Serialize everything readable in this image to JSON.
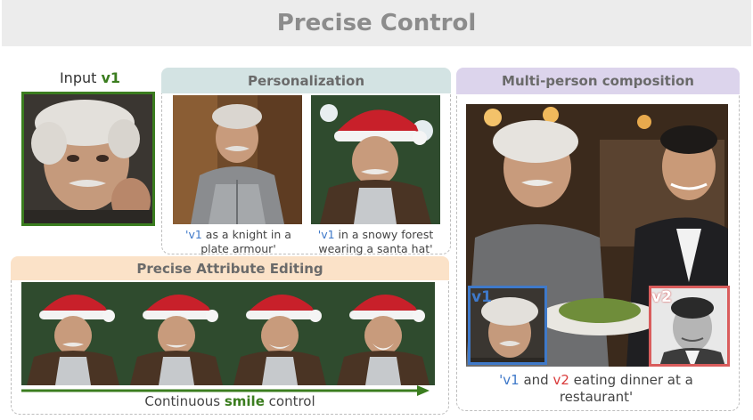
{
  "title": "Precise Control",
  "input": {
    "label_prefix": "Input ",
    "label_token": "v1"
  },
  "personalization": {
    "header": "Personalization",
    "captions": [
      {
        "token": "'v1",
        "text": " as a knight in a plate armour'"
      },
      {
        "token": "'v1",
        "text": " in a snowy forest wearing a santa hat'"
      }
    ]
  },
  "attribute_editing": {
    "header": "Precise Attribute Editing",
    "control_prefix": "Continuous ",
    "control_attr": "smile",
    "control_suffix": " control"
  },
  "multi_person": {
    "header": "Multi-person composition",
    "tag_v1": "v1",
    "tag_v2": "v2",
    "caption_token1": "'v1",
    "caption_mid": " and ",
    "caption_token2": "v2",
    "caption_rest": " eating dinner at a restaurant'"
  },
  "colors": {
    "v1_accent": "#3b7d1f",
    "token_blue": "#3f79c9",
    "token_red": "#d93b3b",
    "personalization_bg": "#d3e3e3",
    "attribute_bg": "#fbe2c8",
    "multi_bg": "#dcd4ec"
  },
  "icons": [
    "einstein-portrait",
    "knight-portrait",
    "santa-portrait",
    "restaurant-scene",
    "feynman-portrait",
    "right-arrow-icon"
  ]
}
